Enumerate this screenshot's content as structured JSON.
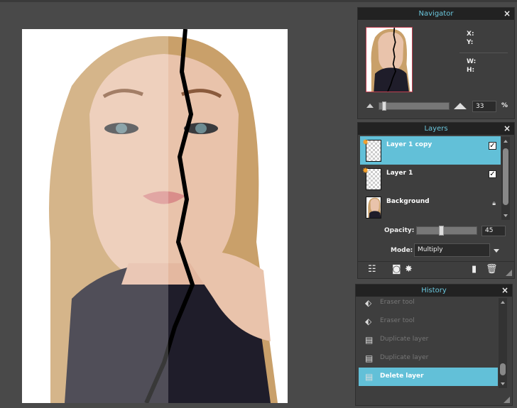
{
  "navigator": {
    "title": "Navigator",
    "close": "×",
    "x_label": "X:",
    "y_label": "Y:",
    "w_label": "W:",
    "h_label": "H:",
    "zoom_value": "33",
    "zoom_unit": "%"
  },
  "layers": {
    "title": "Layers",
    "close": "×",
    "items": [
      {
        "name": "Layer 1 copy",
        "selected": true,
        "visible": true
      },
      {
        "name": "Layer 1",
        "selected": false,
        "visible": true
      },
      {
        "name": "Background",
        "selected": false,
        "locked": true
      }
    ],
    "check_glyph": "✓",
    "lock_glyph": "🔒",
    "opacity_label": "Opacity:",
    "opacity_value": "45",
    "mode_label": "Mode:",
    "mode_value": "Multiply",
    "toolbar": {
      "adjust_icon": "sliders-icon",
      "mask_icon": "mask-icon",
      "fx_icon": "effects-icon",
      "new_icon": "new-layer-icon",
      "trash_icon": "trash-icon"
    }
  },
  "history": {
    "title": "History",
    "close": "×",
    "items": [
      {
        "label": "Eraser tool",
        "icon": "eraser-icon"
      },
      {
        "label": "Eraser tool",
        "icon": "eraser-icon"
      },
      {
        "label": "Duplicate layer",
        "icon": "duplicate-layer-icon"
      },
      {
        "label": "Duplicate layer",
        "icon": "duplicate-layer-icon"
      },
      {
        "label": "Delete layer",
        "icon": "delete-layer-icon",
        "selected": true
      }
    ]
  },
  "colors": {
    "accent": "#62c0d8",
    "title_text": "#6ac6dc",
    "panel_bg": "#3e3e3e",
    "header_bg": "#222222",
    "workspace": "#494949"
  }
}
